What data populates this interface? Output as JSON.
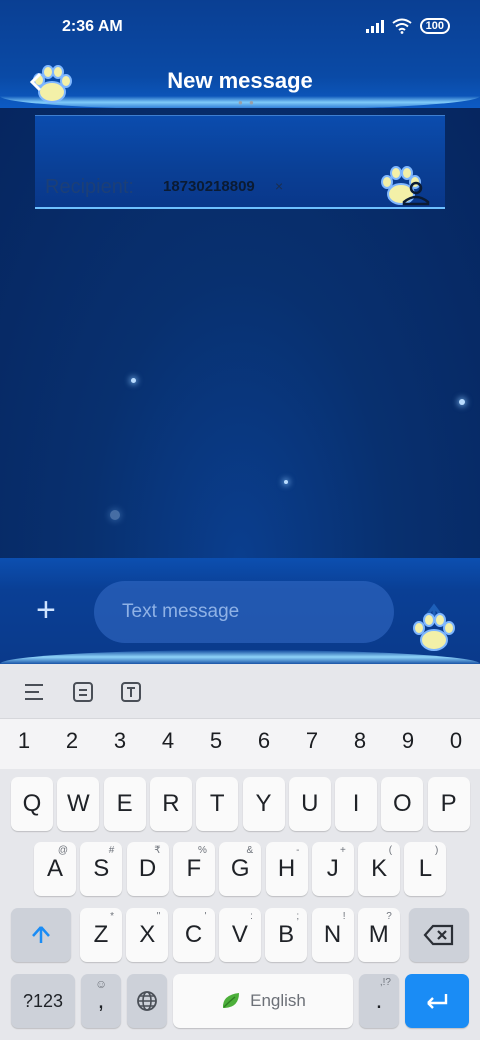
{
  "status_bar": {
    "time": "2:36 AM",
    "battery": "100"
  },
  "header": {
    "title": "New message",
    "back_icon": "paw-back-icon"
  },
  "recipient": {
    "label": "Recipient:",
    "number": "18730218809",
    "remove": "×"
  },
  "composer": {
    "add": "+",
    "placeholder": "Text message"
  },
  "keyboard": {
    "toolbar": [
      "menu-lines-icon",
      "clipboard-icon",
      "text-format-icon"
    ],
    "numbers": [
      "1",
      "2",
      "3",
      "4",
      "5",
      "6",
      "7",
      "8",
      "9",
      "0"
    ],
    "row1": [
      {
        "k": "Q",
        "h": ""
      },
      {
        "k": "W",
        "h": ""
      },
      {
        "k": "E",
        "h": ""
      },
      {
        "k": "R",
        "h": ""
      },
      {
        "k": "T",
        "h": ""
      },
      {
        "k": "Y",
        "h": ""
      },
      {
        "k": "U",
        "h": ""
      },
      {
        "k": "I",
        "h": ""
      },
      {
        "k": "O",
        "h": ""
      },
      {
        "k": "P",
        "h": ""
      }
    ],
    "row2": [
      {
        "k": "A",
        "h": "@"
      },
      {
        "k": "S",
        "h": "#"
      },
      {
        "k": "D",
        "h": "₹"
      },
      {
        "k": "F",
        "h": "%"
      },
      {
        "k": "G",
        "h": "&"
      },
      {
        "k": "H",
        "h": "-"
      },
      {
        "k": "J",
        "h": "+"
      },
      {
        "k": "K",
        "h": "("
      },
      {
        "k": "L",
        "h": ")"
      }
    ],
    "row3": [
      {
        "k": "Z",
        "h": "*"
      },
      {
        "k": "X",
        "h": "\""
      },
      {
        "k": "C",
        "h": "'"
      },
      {
        "k": "V",
        "h": ":"
      },
      {
        "k": "B",
        "h": ";"
      },
      {
        "k": "N",
        "h": "!"
      },
      {
        "k": "M",
        "h": "?"
      }
    ],
    "symbols_label": "?123",
    "comma": ",",
    "space_label": "English",
    "period": ".",
    "period_hint": ",!?"
  },
  "colors": {
    "accent": "#1a8cf5",
    "header": "#0a3f93",
    "background": "#07306e"
  }
}
